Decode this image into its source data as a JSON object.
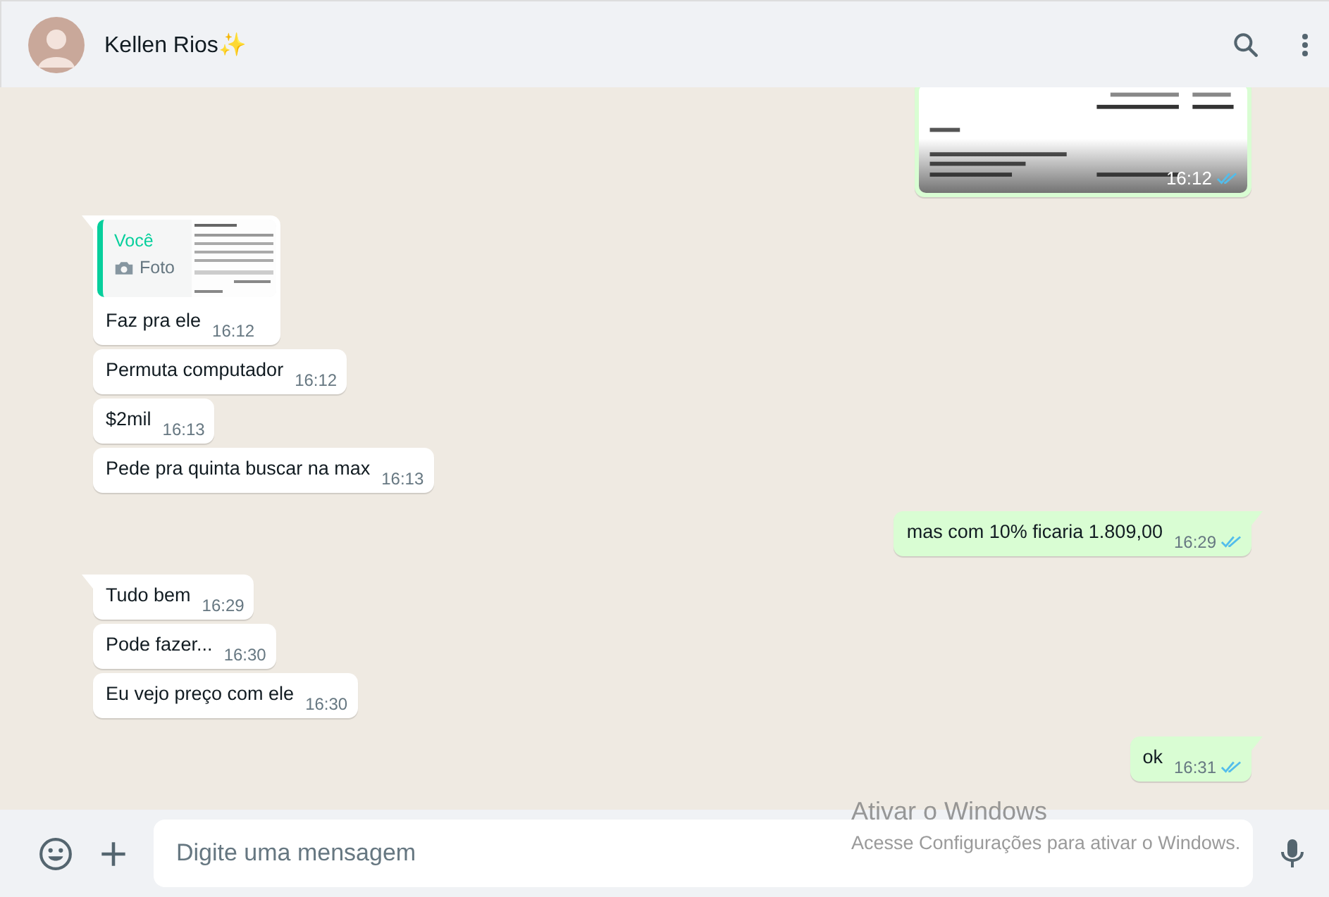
{
  "header": {
    "contact_name": "Kellen Rios✨"
  },
  "messages": [
    {
      "outgoing": true,
      "tail": false,
      "time": "16:12",
      "read": true
    },
    {
      "kind": "quote",
      "outgoing": false,
      "tail": true,
      "quote_author": "Você",
      "quote_label": "Foto",
      "text": "Faz pra ele",
      "time": "16:12"
    },
    {
      "kind": "text",
      "outgoing": false,
      "tail": false,
      "text": "Permuta computador",
      "time": "16:12"
    },
    {
      "kind": "text",
      "outgoing": false,
      "tail": false,
      "text": "$2mil",
      "time": "16:13"
    },
    {
      "kind": "text",
      "outgoing": false,
      "tail": false,
      "text": "Pede pra quinta buscar na max",
      "time": "16:13"
    },
    {
      "kind": "text",
      "outgoing": true,
      "tail": true,
      "text": "mas com 10% ficaria 1.809,00",
      "time": "16:29",
      "read": true
    },
    {
      "kind": "text",
      "outgoing": false,
      "tail": true,
      "text": "Tudo bem",
      "time": "16:29"
    },
    {
      "kind": "text",
      "outgoing": false,
      "tail": false,
      "text": "Pode fazer...",
      "time": "16:30"
    },
    {
      "kind": "text",
      "outgoing": false,
      "tail": false,
      "text": "Eu vejo preço com ele",
      "time": "16:30"
    },
    {
      "kind": "text",
      "outgoing": true,
      "tail": true,
      "text": "ok",
      "time": "16:31",
      "read": true
    }
  ],
  "composer": {
    "placeholder": "Digite uma mensagem"
  },
  "os_watermark": {
    "title": "Ativar o Windows",
    "subtitle": "Acesse Configurações para ativar o Windows."
  }
}
